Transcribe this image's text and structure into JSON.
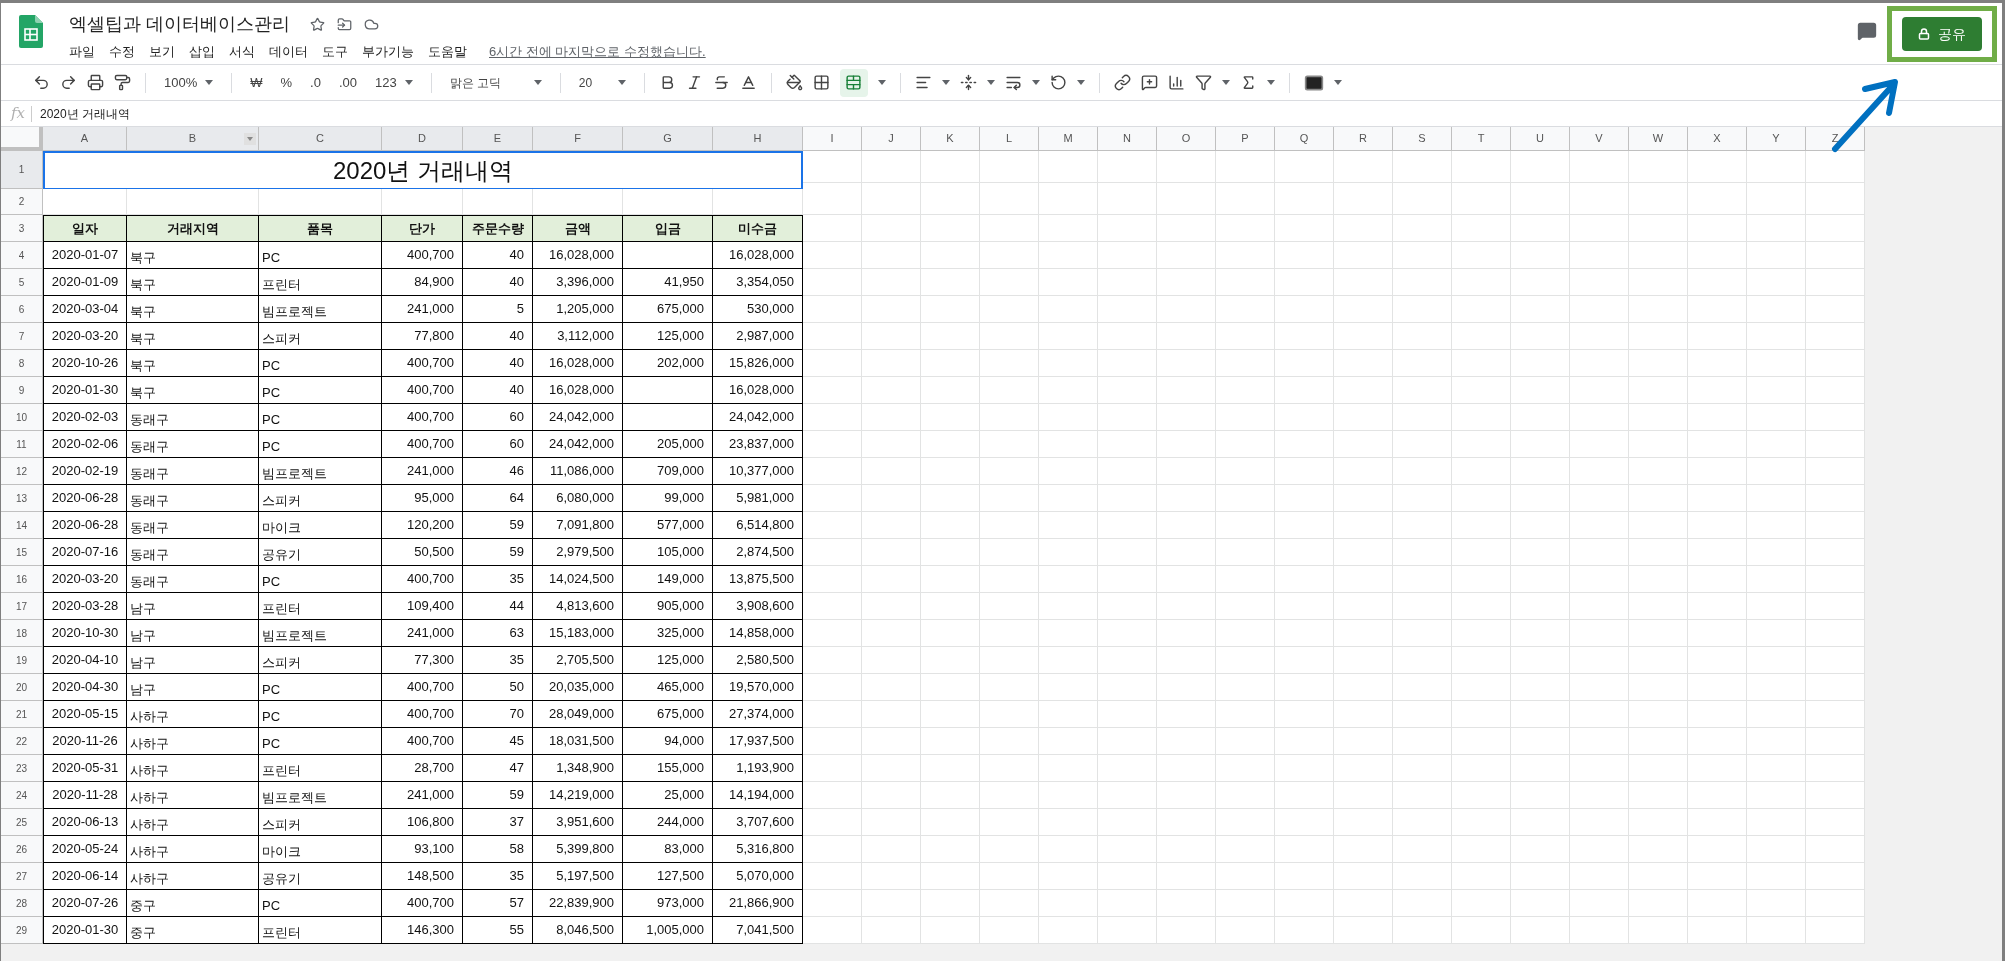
{
  "document": {
    "title": "엑셀팁과 데이터베이스관리",
    "menu": [
      "파일",
      "수정",
      "보기",
      "삽입",
      "서식",
      "데이터",
      "도구",
      "부가기능",
      "도움말"
    ],
    "last_edit": "6시간 전에 마지막으로 수정했습니다."
  },
  "share_button": {
    "label": "공유"
  },
  "toolbar": {
    "zoom": "100%",
    "currency": "₩",
    "percent": "%",
    "decimal_decrease": ".0",
    "decimal_increase": ".00",
    "number_format": "123",
    "font": "맑은 고딕",
    "font_size": "20",
    "merge_selected": true
  },
  "formula_bar": {
    "label": "fx",
    "value": "2020년 거래내역"
  },
  "sheet": {
    "columns": [
      {
        "label": "A",
        "selected": true
      },
      {
        "label": "B",
        "selected": true
      },
      {
        "label": "C",
        "selected": true
      },
      {
        "label": "D",
        "selected": true
      },
      {
        "label": "E",
        "selected": true
      },
      {
        "label": "F",
        "selected": true
      },
      {
        "label": "G",
        "selected": true
      },
      {
        "label": "H",
        "selected": true
      },
      {
        "label": "I",
        "selected": false
      },
      {
        "label": "J",
        "selected": false
      },
      {
        "label": "K",
        "selected": false
      },
      {
        "label": "L",
        "selected": false
      },
      {
        "label": "M",
        "selected": false
      },
      {
        "label": "N",
        "selected": false
      },
      {
        "label": "O",
        "selected": false
      },
      {
        "label": "P",
        "selected": false
      },
      {
        "label": "Q",
        "selected": false
      },
      {
        "label": "R",
        "selected": false
      },
      {
        "label": "S",
        "selected": false
      },
      {
        "label": "T",
        "selected": false
      },
      {
        "label": "U",
        "selected": false
      },
      {
        "label": "V",
        "selected": false
      },
      {
        "label": "W",
        "selected": false
      },
      {
        "label": "X",
        "selected": false
      },
      {
        "label": "Y",
        "selected": false
      },
      {
        "label": "Z",
        "selected": false
      }
    ],
    "row_numbers": [
      {
        "label": "1",
        "selected": true
      },
      {
        "label": "2",
        "selected": false
      },
      {
        "label": "3",
        "selected": false
      },
      {
        "label": "4",
        "selected": false
      },
      {
        "label": "5",
        "selected": false
      },
      {
        "label": "6",
        "selected": false
      },
      {
        "label": "7",
        "selected": false
      },
      {
        "label": "8",
        "selected": false
      },
      {
        "label": "9",
        "selected": false
      },
      {
        "label": "10",
        "selected": false
      },
      {
        "label": "11",
        "selected": false
      },
      {
        "label": "12",
        "selected": false
      },
      {
        "label": "13",
        "selected": false
      },
      {
        "label": "14",
        "selected": false
      },
      {
        "label": "15",
        "selected": false
      },
      {
        "label": "16",
        "selected": false
      },
      {
        "label": "17",
        "selected": false
      },
      {
        "label": "18",
        "selected": false
      },
      {
        "label": "19",
        "selected": false
      },
      {
        "label": "20",
        "selected": false
      },
      {
        "label": "21",
        "selected": false
      },
      {
        "label": "22",
        "selected": false
      },
      {
        "label": "23",
        "selected": false
      },
      {
        "label": "24",
        "selected": false
      },
      {
        "label": "25",
        "selected": false
      },
      {
        "label": "26",
        "selected": false
      },
      {
        "label": "27",
        "selected": false
      },
      {
        "label": "28",
        "selected": false
      },
      {
        "label": "29",
        "selected": false
      }
    ],
    "title_cell": {
      "text": "2020년 거래내역",
      "selected": true
    },
    "headers": [
      "일자",
      "거래지역",
      "품목",
      "단가",
      "주문수량",
      "금액",
      "입금",
      "미수금"
    ],
    "rows": [
      {
        "date": "2020-01-07",
        "region": "북구",
        "item": "PC",
        "price": "400,700",
        "qty": "40",
        "amount": "16,028,000",
        "balance": "16,028,000"
      },
      {
        "date": "2020-01-09",
        "region": "북구",
        "item": "프린터",
        "price": "84,900",
        "qty": "40",
        "amount": "3,396,000",
        "deposit": "41,950",
        "balance": "3,354,050"
      },
      {
        "date": "2020-03-04",
        "region": "북구",
        "item": "빔프로젝트",
        "price": "241,000",
        "qty": "5",
        "amount": "1,205,000",
        "deposit": "675,000",
        "balance": "530,000"
      },
      {
        "date": "2020-03-20",
        "region": "북구",
        "item": "스피커",
        "price": "77,800",
        "qty": "40",
        "amount": "3,112,000",
        "deposit": "125,000",
        "balance": "2,987,000"
      },
      {
        "date": "2020-10-26",
        "region": "북구",
        "item": "PC",
        "price": "400,700",
        "qty": "40",
        "amount": "16,028,000",
        "deposit": "202,000",
        "balance": "15,826,000"
      },
      {
        "date": "2020-01-30",
        "region": "북구",
        "item": "PC",
        "price": "400,700",
        "qty": "40",
        "amount": "16,028,000",
        "balance": "16,028,000"
      },
      {
        "date": "2020-02-03",
        "region": "동래구",
        "item": "PC",
        "price": "400,700",
        "qty": "60",
        "amount": "24,042,000",
        "balance": "24,042,000"
      },
      {
        "date": "2020-02-06",
        "region": "동래구",
        "item": "PC",
        "price": "400,700",
        "qty": "60",
        "amount": "24,042,000",
        "deposit": "205,000",
        "balance": "23,837,000"
      },
      {
        "date": "2020-02-19",
        "region": "동래구",
        "item": "빔프로젝트",
        "price": "241,000",
        "qty": "46",
        "amount": "11,086,000",
        "deposit": "709,000",
        "balance": "10,377,000"
      },
      {
        "date": "2020-06-28",
        "region": "동래구",
        "item": "스피커",
        "price": "95,000",
        "qty": "64",
        "amount": "6,080,000",
        "deposit": "99,000",
        "balance": "5,981,000"
      },
      {
        "date": "2020-06-28",
        "region": "동래구",
        "item": "마이크",
        "price": "120,200",
        "qty": "59",
        "amount": "7,091,800",
        "deposit": "577,000",
        "balance": "6,514,800"
      },
      {
        "date": "2020-07-16",
        "region": "동래구",
        "item": "공유기",
        "price": "50,500",
        "qty": "59",
        "amount": "2,979,500",
        "deposit": "105,000",
        "balance": "2,874,500"
      },
      {
        "date": "2020-03-20",
        "region": "동래구",
        "item": "PC",
        "price": "400,700",
        "qty": "35",
        "amount": "14,024,500",
        "deposit": "149,000",
        "balance": "13,875,500"
      },
      {
        "date": "2020-03-28",
        "region": "남구",
        "item": "프린터",
        "price": "109,400",
        "qty": "44",
        "amount": "4,813,600",
        "deposit": "905,000",
        "balance": "3,908,600"
      },
      {
        "date": "2020-10-30",
        "region": "남구",
        "item": "빔프로젝트",
        "price": "241,000",
        "qty": "63",
        "amount": "15,183,000",
        "deposit": "325,000",
        "balance": "14,858,000"
      },
      {
        "date": "2020-04-10",
        "region": "남구",
        "item": "스피커",
        "price": "77,300",
        "qty": "35",
        "amount": "2,705,500",
        "deposit": "125,000",
        "balance": "2,580,500"
      },
      {
        "date": "2020-04-30",
        "region": "남구",
        "item": "PC",
        "price": "400,700",
        "qty": "50",
        "amount": "20,035,000",
        "deposit": "465,000",
        "balance": "19,570,000"
      },
      {
        "date": "2020-05-15",
        "region": "사하구",
        "item": "PC",
        "price": "400,700",
        "qty": "70",
        "amount": "28,049,000",
        "deposit": "675,000",
        "balance": "27,374,000"
      },
      {
        "date": "2020-11-26",
        "region": "사하구",
        "item": "PC",
        "price": "400,700",
        "qty": "45",
        "amount": "18,031,500",
        "deposit": "94,000",
        "balance": "17,937,500"
      },
      {
        "date": "2020-05-31",
        "region": "사하구",
        "item": "프린터",
        "price": "28,700",
        "qty": "47",
        "amount": "1,348,900",
        "deposit": "155,000",
        "balance": "1,193,900"
      },
      {
        "date": "2020-11-28",
        "region": "사하구",
        "item": "빔프로젝트",
        "price": "241,000",
        "qty": "59",
        "amount": "14,219,000",
        "deposit": "25,000",
        "balance": "14,194,000"
      },
      {
        "date": "2020-06-13",
        "region": "사하구",
        "item": "스피커",
        "price": "106,800",
        "qty": "37",
        "amount": "3,951,600",
        "deposit": "244,000",
        "balance": "3,707,600"
      },
      {
        "date": "2020-05-24",
        "region": "사하구",
        "item": "마이크",
        "price": "93,100",
        "qty": "58",
        "amount": "5,399,800",
        "deposit": "83,000",
        "balance": "5,316,800"
      },
      {
        "date": "2020-06-14",
        "region": "사하구",
        "item": "공유기",
        "price": "148,500",
        "qty": "35",
        "amount": "5,197,500",
        "deposit": "127,500",
        "balance": "5,070,000"
      },
      {
        "date": "2020-07-26",
        "region": "중구",
        "item": "PC",
        "price": "400,700",
        "qty": "57",
        "amount": "22,839,900",
        "deposit": "973,000",
        "balance": "21,866,900"
      },
      {
        "date": "2020-01-30",
        "region": "중구",
        "item": "프린터",
        "price": "146,300",
        "qty": "55",
        "amount": "8,046,500",
        "deposit": "1,005,000",
        "balance": "7,041,500"
      }
    ]
  }
}
